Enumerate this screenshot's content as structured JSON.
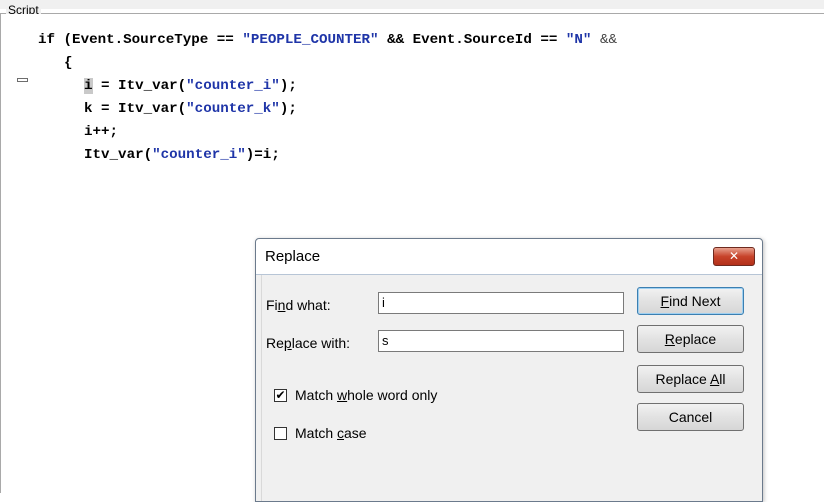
{
  "group": {
    "legend": "Script"
  },
  "code": {
    "line1_prefix": "if (Event.SourceType == ",
    "line1_str1": "\"PEOPLE_COUNTER\"",
    "line1_mid": " && Event.SourceId == ",
    "line1_str2": "\"N\"",
    "line1_tail": " &&",
    "line2": "{",
    "line3_sel": "i",
    "line3_rest": " = Itv_var(",
    "line3_str": "\"counter_i\"",
    "line3_end": ");",
    "line4_prefix": "k = Itv_var(",
    "line4_str": "\"counter_k\"",
    "line4_end": ");",
    "line5": "i++;",
    "line6_prefix": "Itv_var(",
    "line6_str": "\"counter_i\"",
    "line6_end": ")=i;"
  },
  "dialog": {
    "title": "Replace",
    "close_glyph": "✕",
    "find_label_pre": "Fi",
    "find_label_u": "n",
    "find_label_post": "d what:",
    "find_value": "i",
    "replace_label_pre": "Re",
    "replace_label_u": "p",
    "replace_label_post": "lace with:",
    "replace_value": "s",
    "find_next_u": "F",
    "find_next_rest": "ind Next",
    "replace_u": "R",
    "replace_rest": "eplace",
    "replace_all_pre": "Replace ",
    "replace_all_u": "A",
    "replace_all_post": "ll",
    "cancel": "Cancel",
    "match_whole_pre": "Match ",
    "match_whole_u": "w",
    "match_whole_post": "hole word only",
    "match_whole_checked": true,
    "match_case_pre": "Match ",
    "match_case_u": "c",
    "match_case_post": "ase",
    "match_case_checked": false
  }
}
